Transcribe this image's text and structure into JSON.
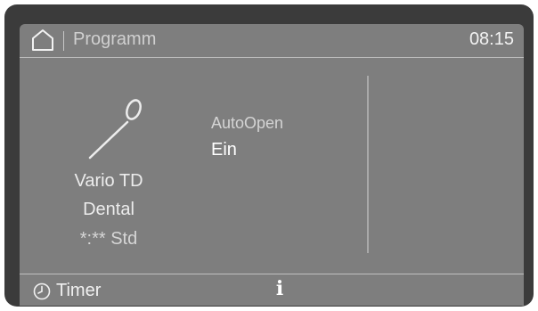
{
  "header": {
    "icon": "home-icon",
    "title": "Programm",
    "time": "08:15"
  },
  "program": {
    "icon": "dental-mirror-icon",
    "name": "Vario TD",
    "subtitle": "Dental",
    "duration": "*:** Std"
  },
  "option": {
    "label": "AutoOpen",
    "value": "Ein"
  },
  "footer": {
    "timer_icon": "clock-icon",
    "timer_label": "Timer",
    "info_icon": "info-icon",
    "info_glyph": "i"
  },
  "colors": {
    "screen_background": "#7e7e7e",
    "bezel": "#3b3b3b",
    "text": "#f0f0f0"
  }
}
